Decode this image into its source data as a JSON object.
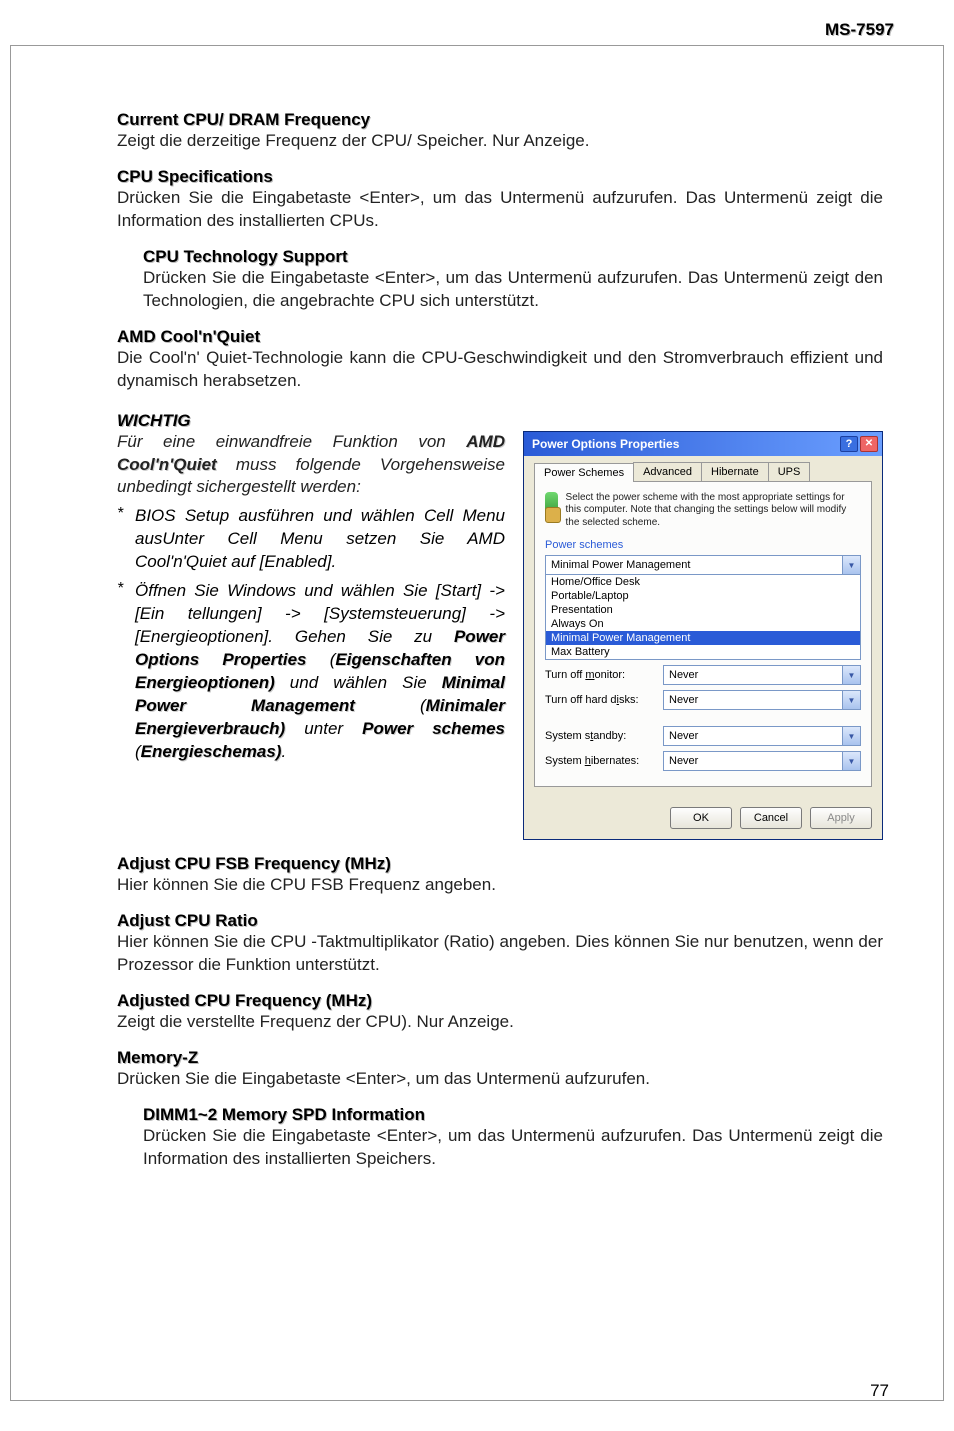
{
  "header": {
    "model": "MS-7597"
  },
  "page_number": "77",
  "sections": {
    "s1": {
      "title": "Current CPU/ DRAM Frequency",
      "body": "Zeigt die derzeitige Frequenz der CPU/ Speicher. Nur Anzeige."
    },
    "s2": {
      "title": "CPU Specifications",
      "body": "Drücken Sie die Eingabetaste <Enter>, um das Untermenü aufzurufen. Das Untermenü zeigt die Information des installierten CPUs."
    },
    "s3": {
      "title": "CPU Technology Support",
      "body": "Drücken Sie die Eingabetaste <Enter>, um das Untermenü aufzurufen.  Das Untermenü zeigt den Technologien, die angebrachte CPU sich  unterstützt."
    },
    "s4": {
      "title": "AMD Cool'n'Quiet",
      "body": "Die Cool'n' Quiet-Technologie kann die CPU-Geschwindigkeit und den Stromverbrauch effizient und dynamisch herabsetzen."
    },
    "wichtig": {
      "label": "WICHTIG",
      "intro_pre": "Für eine einwandfreie Funktion von ",
      "intro_b1": "AMD Cool'n'Quiet",
      "intro_post": " muss folgende Vorgehensweise unbedingt sichergestellt werden:",
      "b1": "BIOS Setup ausführen und wählen Cell Menu ausUnter Cell Menu setzen Sie AMD Cool'n'Quiet auf [Enabled].",
      "b2_a": "Öffnen Sie Windows und wählen Sie [Start] -> [Ein tellungen] -> [Systemsteuerung] -> [Energieoptionen]. Gehen Sie zu ",
      "b2_p1": "Power Options Properties",
      "b2_p1a": " (",
      "b2_p2": "Eigenschaften von Energieoptionen)",
      "b2_mid": " und wählen Sie ",
      "b2_p3": "Minimal Power Management",
      "b2_p3a": " (",
      "b2_p4": "Minimaler Energieverbrauch)",
      "b2_mid2": " unter ",
      "b2_p5": "Power schemes",
      "b2_p5a": " (",
      "b2_p6": "Energieschemas)",
      "b2_end": "."
    },
    "s5": {
      "title": "Adjust CPU FSB Frequency (MHz)",
      "body": "Hier können Sie die CPU FSB Frequenz angeben."
    },
    "s6": {
      "title": "Adjust CPU Ratio",
      "body": "Hier können Sie die CPU -Taktmultiplikator (Ratio) angeben. Dies können Sie nur benutzen, wenn der Prozessor die Funktion unterstützt."
    },
    "s7": {
      "title": "Adjusted CPU Frequency (MHz)",
      "body": "Zeigt die verstellte Frequenz der CPU). Nur Anzeige."
    },
    "s8": {
      "title": "Memory-Z",
      "body": "Drücken Sie die Eingabetaste <Enter>, um das Untermenü aufzurufen."
    },
    "s9": {
      "title": "DIMM1~2 Memory SPD Information",
      "body": "Drücken Sie die Eingabetaste <Enter>, um das Untermenü aufzurufen. Das Untermenü zeigt die Information des installierten Speichers."
    }
  },
  "dialog": {
    "title": "Power Options Properties",
    "tabs": [
      "Power Schemes",
      "Advanced",
      "Hibernate",
      "UPS"
    ],
    "desc": "Select the power scheme with the most appropriate settings for this computer. Note that changing the settings below will modify the selected scheme.",
    "group_label": "Power schemes",
    "scheme_selected": "Minimal Power Management",
    "scheme_options": [
      "Home/Office Desk",
      "Portable/Laptop",
      "Presentation",
      "Always On",
      "Minimal Power Management",
      "Max Battery"
    ],
    "settings": {
      "monitor": {
        "label": "Turn off monitor:",
        "value": "Never"
      },
      "disks": {
        "label": "Turn off hard disks:",
        "value": "Never"
      },
      "standby": {
        "label": "System standby:",
        "value": "Never"
      },
      "hibernate": {
        "label": "System hibernates:",
        "value": "Never"
      }
    },
    "buttons": {
      "ok": "OK",
      "cancel": "Cancel",
      "apply": "Apply"
    }
  }
}
